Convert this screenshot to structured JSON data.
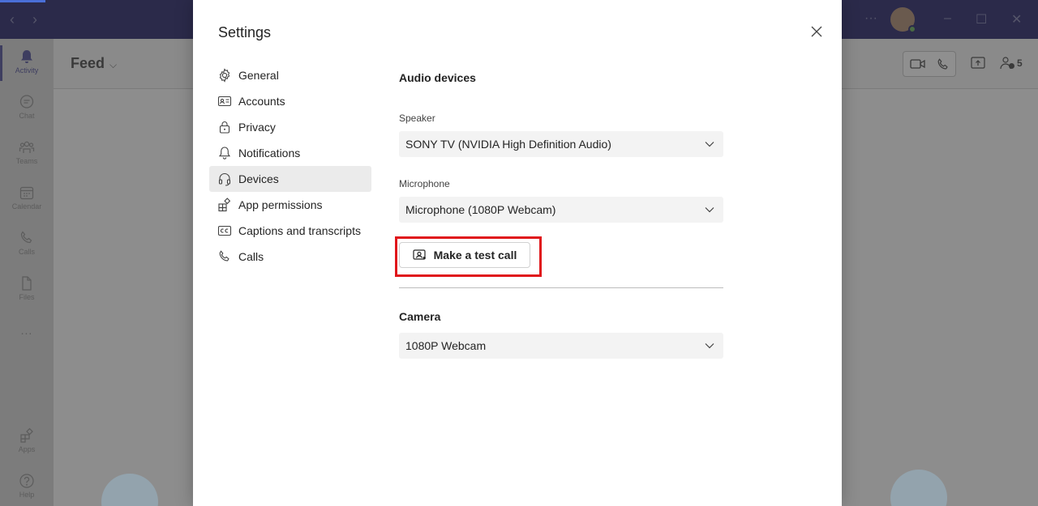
{
  "app": {
    "rail": [
      {
        "label": "Activity",
        "icon": "bell-icon",
        "active": true
      },
      {
        "label": "Chat",
        "icon": "chat-icon"
      },
      {
        "label": "Teams",
        "icon": "teams-icon"
      },
      {
        "label": "Calendar",
        "icon": "calendar-icon"
      },
      {
        "label": "Calls",
        "icon": "phone-icon"
      },
      {
        "label": "Files",
        "icon": "file-icon"
      },
      {
        "label": "...",
        "icon": "more-icon"
      },
      {
        "label": "Apps",
        "icon": "apps-icon"
      },
      {
        "label": "Help",
        "icon": "help-icon"
      }
    ],
    "feed_title": "Feed",
    "participant_count": "5"
  },
  "dialog": {
    "title": "Settings",
    "nav": [
      {
        "label": "General",
        "icon": "gear-icon"
      },
      {
        "label": "Accounts",
        "icon": "id-card-icon"
      },
      {
        "label": "Privacy",
        "icon": "lock-icon"
      },
      {
        "label": "Notifications",
        "icon": "bell-icon"
      },
      {
        "label": "Devices",
        "icon": "headset-icon",
        "active": true
      },
      {
        "label": "App permissions",
        "icon": "apps-icon"
      },
      {
        "label": "Captions and transcripts",
        "icon": "cc-icon"
      },
      {
        "label": "Calls",
        "icon": "phone-icon"
      }
    ],
    "devices": {
      "audio_title": "Audio devices",
      "speaker_label": "Speaker",
      "speaker_value": "SONY TV (NVIDIA High Definition Audio)",
      "microphone_label": "Microphone",
      "microphone_value": "Microphone (1080P Webcam)",
      "test_call_label": "Make a test call",
      "camera_title": "Camera",
      "camera_value": "1080P Webcam"
    }
  },
  "colors": {
    "highlight": "#e0161b",
    "titlebar": "#2b2a4a",
    "active_nav": "#ebebeb"
  }
}
